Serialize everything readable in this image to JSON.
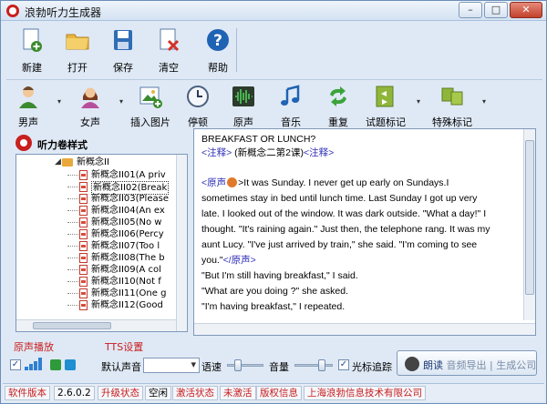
{
  "window": {
    "title": "浪勃听力生成器",
    "controls": {
      "minimize": "–",
      "maximize": "□",
      "close": "✕"
    }
  },
  "toolbar_main": [
    {
      "key": "new",
      "label": "新建",
      "icon": "new-doc-icon",
      "color": "#3b8b2e"
    },
    {
      "key": "open",
      "label": "打开",
      "icon": "folder-icon",
      "color": "#e8b53f"
    },
    {
      "key": "save",
      "label": "保存",
      "icon": "save-disk-icon",
      "color": "#2f6db5"
    },
    {
      "key": "clear",
      "label": "清空",
      "icon": "clear-doc-icon",
      "color": "#d0332a"
    },
    {
      "key": "help",
      "label": "帮助",
      "icon": "help-icon",
      "color": "#1f63b4"
    }
  ],
  "toolbar_insert": [
    {
      "key": "male",
      "label": "男声",
      "icon": "male-voice-icon",
      "has_menu": true
    },
    {
      "key": "female",
      "label": "女声",
      "icon": "female-voice-icon",
      "has_menu": true
    },
    {
      "key": "image",
      "label": "插入图片",
      "icon": "insert-image-icon",
      "has_menu": false
    },
    {
      "key": "pause",
      "label": "停顿",
      "icon": "clock-icon",
      "has_menu": false
    },
    {
      "key": "original",
      "label": "原声",
      "icon": "waveform-icon",
      "has_menu": false
    },
    {
      "key": "music",
      "label": "音乐",
      "icon": "music-note-icon",
      "has_menu": false
    },
    {
      "key": "repeat",
      "label": "重复",
      "icon": "repeat-icon",
      "has_menu": false
    },
    {
      "key": "question",
      "label": "试题标记",
      "icon": "question-mark-icon",
      "has_menu": true
    },
    {
      "key": "special",
      "label": "特殊标记",
      "icon": "special-mark-icon",
      "has_menu": true
    }
  ],
  "left_panel": {
    "title": "听力卷样式",
    "root": "新概念II",
    "items": [
      "新概念II01(A priv",
      "新概念II02(Break",
      "新概念II03(Please",
      "新概念II04(An ex",
      "新概念II05(No w",
      "新概念II06(Percy",
      "新概念II07(Too l",
      "新概念II08(The b",
      "新概念II09(A col",
      "新概念II10(Not f",
      "新概念II11(One g",
      "新概念II12(Good"
    ],
    "selected_index": 1
  },
  "editor": {
    "heading": "BREAKFAST OR LUNCH?",
    "note_open": "<注释>",
    "note_text": " (新概念二第2课)",
    "note_close": "<注释>",
    "orig_open": "<原声",
    "orig_after": ">It was Sunday. I never get up early on Sundays.I",
    "body_lines": [
      "sometimes stay in bed until lunch time. Last Sunday I got up very",
      "late. I looked out of the window. It was dark outside. \"What a day!\" I",
      "thought. \"It's raining again.\" Just then, the telephone rang. It was my",
      "aunt Lucy. \"I've just arrived by train,\" she said. \"I'm coming to see"
    ],
    "last_orig_text": "you.\"",
    "orig_close": "</原声",
    "orig_close_end": ">",
    "tail_lines": [
      "\"But I'm still having breakfast,\" I said.",
      "\"What are you doing ?\" she asked.",
      "\"I'm having breakfast,\" I repeated."
    ]
  },
  "bottom": {
    "original_play_label": "原声播放",
    "tts_label": "TTS设置",
    "default_voice_label": "默认声音",
    "rate_label": "语速",
    "volume_label": "音量",
    "cursor_follow_label": "光标追踪",
    "cursor_follow_checked": true,
    "original_checked": true,
    "read_button_label": "朗读",
    "read_button_extra": "音频导出 | 生成公司"
  },
  "status_bar": {
    "version_label": "软件版本",
    "version_value": "2.6.0.2",
    "upgrade_label": "升级状态",
    "upgrade_value": "空闲",
    "activate_label": "激活状态",
    "activate_value": "未激活",
    "copyright_label": "版权信息",
    "copyright_value": "上海浪勃信息技术有限公司"
  }
}
